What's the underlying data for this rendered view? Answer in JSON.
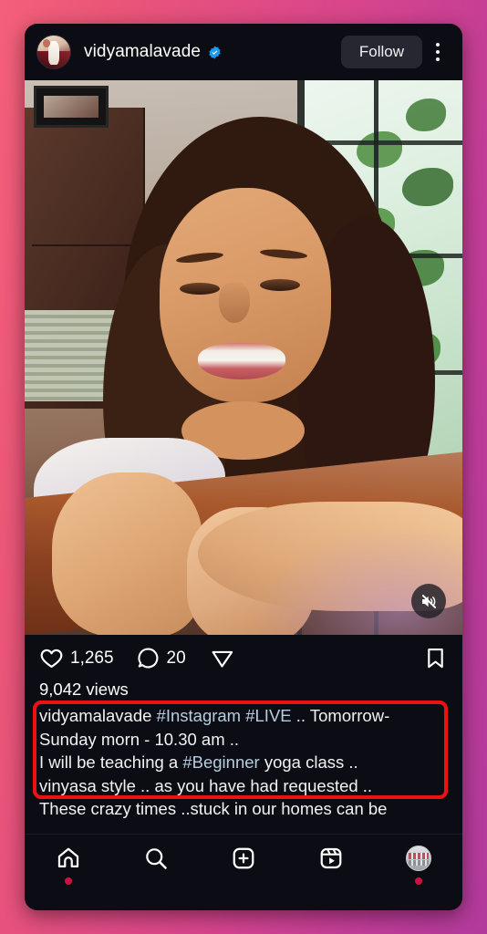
{
  "app": {
    "name": "instagram-post-view"
  },
  "post_header": {
    "username": "vidyamalavade",
    "verified_icon": "verified-badge-icon",
    "follow_label": "Follow",
    "more_options_icon": "kebab-menu-icon",
    "avatar_icon": "profile-avatar"
  },
  "media": {
    "mute_icon": "speaker-muted-icon",
    "type": "video"
  },
  "actions": {
    "like_icon": "heart-icon",
    "like_count": "1,265",
    "comment_icon": "comment-bubble-icon",
    "comment_count": "20",
    "share_icon": "share-paper-plane-icon",
    "save_icon": "bookmark-icon"
  },
  "stats": {
    "views": "9,042 views"
  },
  "caption": {
    "author": "vidyamalavade",
    "segments": [
      {
        "text": "vidyamalavade ",
        "type": "plain"
      },
      {
        "text": "#Instagram",
        "type": "hashtag"
      },
      {
        "text": " ",
        "type": "plain"
      },
      {
        "text": "#LIVE",
        "type": "hashtag"
      },
      {
        "text": " .. Tomorrow-\nSunday morn - 10.30 am ..\nI will be teaching a ",
        "type": "plain"
      },
      {
        "text": "#Beginner",
        "type": "hashtag"
      },
      {
        "text": " yoga class ..\nvinyasa style .. as you have had requested ..\nThese crazy times ..stuck in our homes can be",
        "type": "plain"
      }
    ],
    "full_text": "vidyamalavade #Instagram #LIVE .. Tomorrow-\nSunday morn - 10.30 am ..\nI will be teaching a #Beginner yoga class ..\nvinyasa style .. as you have had requested ..\nThese crazy times ..stuck in our homes can be"
  },
  "annotation": {
    "shape": "rectangle",
    "color": "#ef1111"
  },
  "bottom_nav": {
    "items": [
      {
        "name": "home",
        "icon": "home-icon",
        "badge": true
      },
      {
        "name": "search",
        "icon": "search-icon",
        "badge": false
      },
      {
        "name": "create",
        "icon": "plus-square-icon",
        "badge": false
      },
      {
        "name": "reels",
        "icon": "reels-icon",
        "badge": false
      },
      {
        "name": "profile",
        "icon": "profile-avatar-icon",
        "badge": true
      }
    ]
  },
  "colors": {
    "background_gradient_start": "#f4607a",
    "background_gradient_end": "#b23a9c",
    "card_background": "#0c0d14",
    "hashtag": "#b6cde0",
    "verified_blue": "#1c9bef",
    "annotation_red": "#ef1111",
    "badge_red": "#c91440"
  }
}
